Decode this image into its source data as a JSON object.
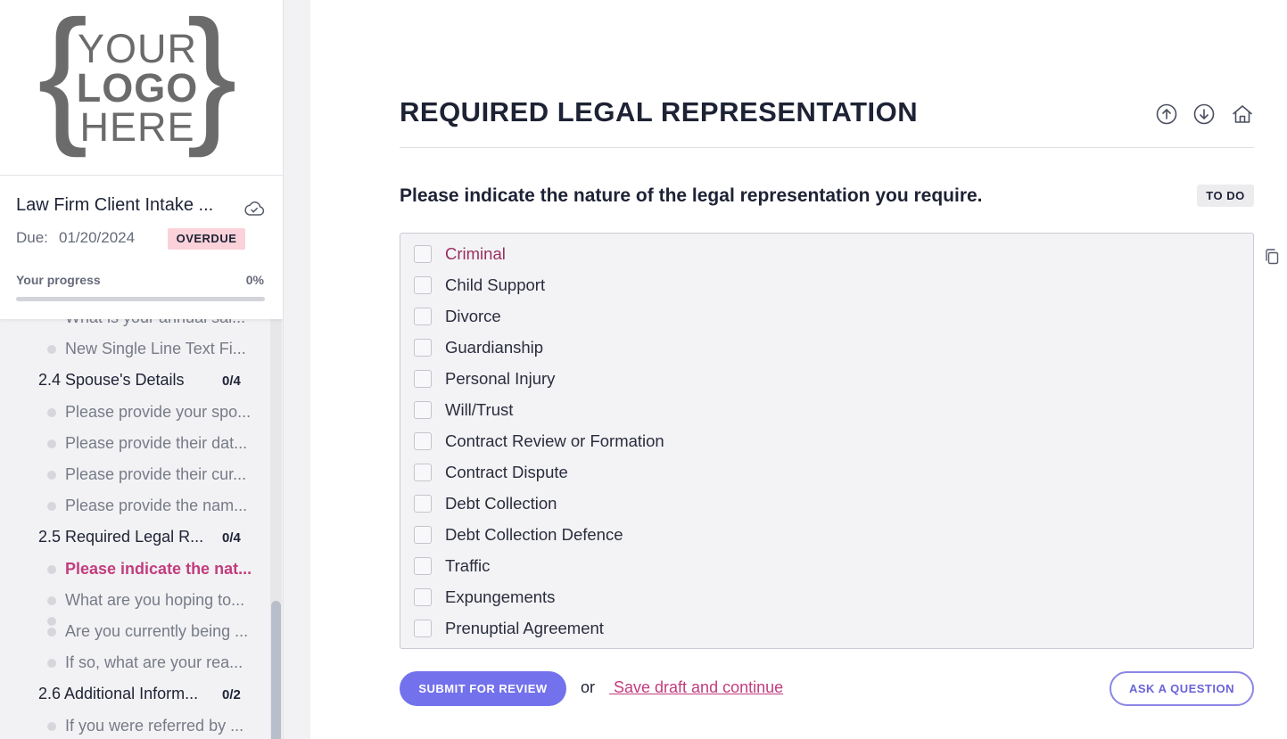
{
  "logo": {
    "line1": "YOUR",
    "line2": "LOGO",
    "line3": "HERE",
    "brace_left": "{",
    "brace_right": "}"
  },
  "form": {
    "title": "Law Firm Client Intake ...",
    "due_label": "Due:",
    "due_date": "01/20/2024",
    "status": "OVERDUE",
    "progress_label": "Your progress",
    "progress_value": "0%",
    "progress_fraction": 0
  },
  "sidebar": {
    "items": [
      {
        "type": "question",
        "label": "What is your annual sal..."
      },
      {
        "type": "question",
        "label": "New Single Line Text Fi..."
      },
      {
        "type": "section",
        "label": "2.4 Spouse's Details",
        "count": "0/4"
      },
      {
        "type": "question",
        "label": "Please provide your spo..."
      },
      {
        "type": "question",
        "label": "Please provide their dat..."
      },
      {
        "type": "question",
        "label": "Please provide their cur..."
      },
      {
        "type": "question",
        "label": "Please provide the nam..."
      },
      {
        "type": "section",
        "label": "2.5 Required Legal R...",
        "count": "0/4"
      },
      {
        "type": "question",
        "label": "Please indicate the nat...",
        "active": true
      },
      {
        "type": "question",
        "label": "What are you hoping to..."
      },
      {
        "type": "question",
        "label": "Are you currently being ..."
      },
      {
        "type": "question",
        "label": "If so, what are your rea..."
      },
      {
        "type": "section",
        "label": "2.6 Additional Inform...",
        "count": "0/2"
      },
      {
        "type": "question",
        "label": "If you were referred by ..."
      }
    ]
  },
  "main": {
    "title": "REQUIRED LEGAL REPRESENTATION",
    "nav_icons": [
      "arrow-up-circle-icon",
      "arrow-down-circle-icon",
      "home-icon"
    ],
    "question": "Please indicate the nature of the legal representation you require.",
    "status_badge": "TO DO",
    "options": [
      "Criminal",
      "Child Support",
      "Divorce",
      "Guardianship",
      "Personal Injury",
      "Will/Trust",
      "Contract Review or Formation",
      "Contract Dispute",
      "Debt Collection",
      "Debt Collection Defence",
      "Traffic",
      "Expungements",
      "Prenuptial Agreement"
    ],
    "submit_label": "SUBMIT FOR REVIEW",
    "or_text": "or",
    "save_link": " Save draft and continue",
    "ask_label": "ASK A QUESTION"
  },
  "colors": {
    "accent": "#7371ec",
    "link": "#c23d7e",
    "overdue_bg": "#fbd2da",
    "text": "#1e2235"
  }
}
